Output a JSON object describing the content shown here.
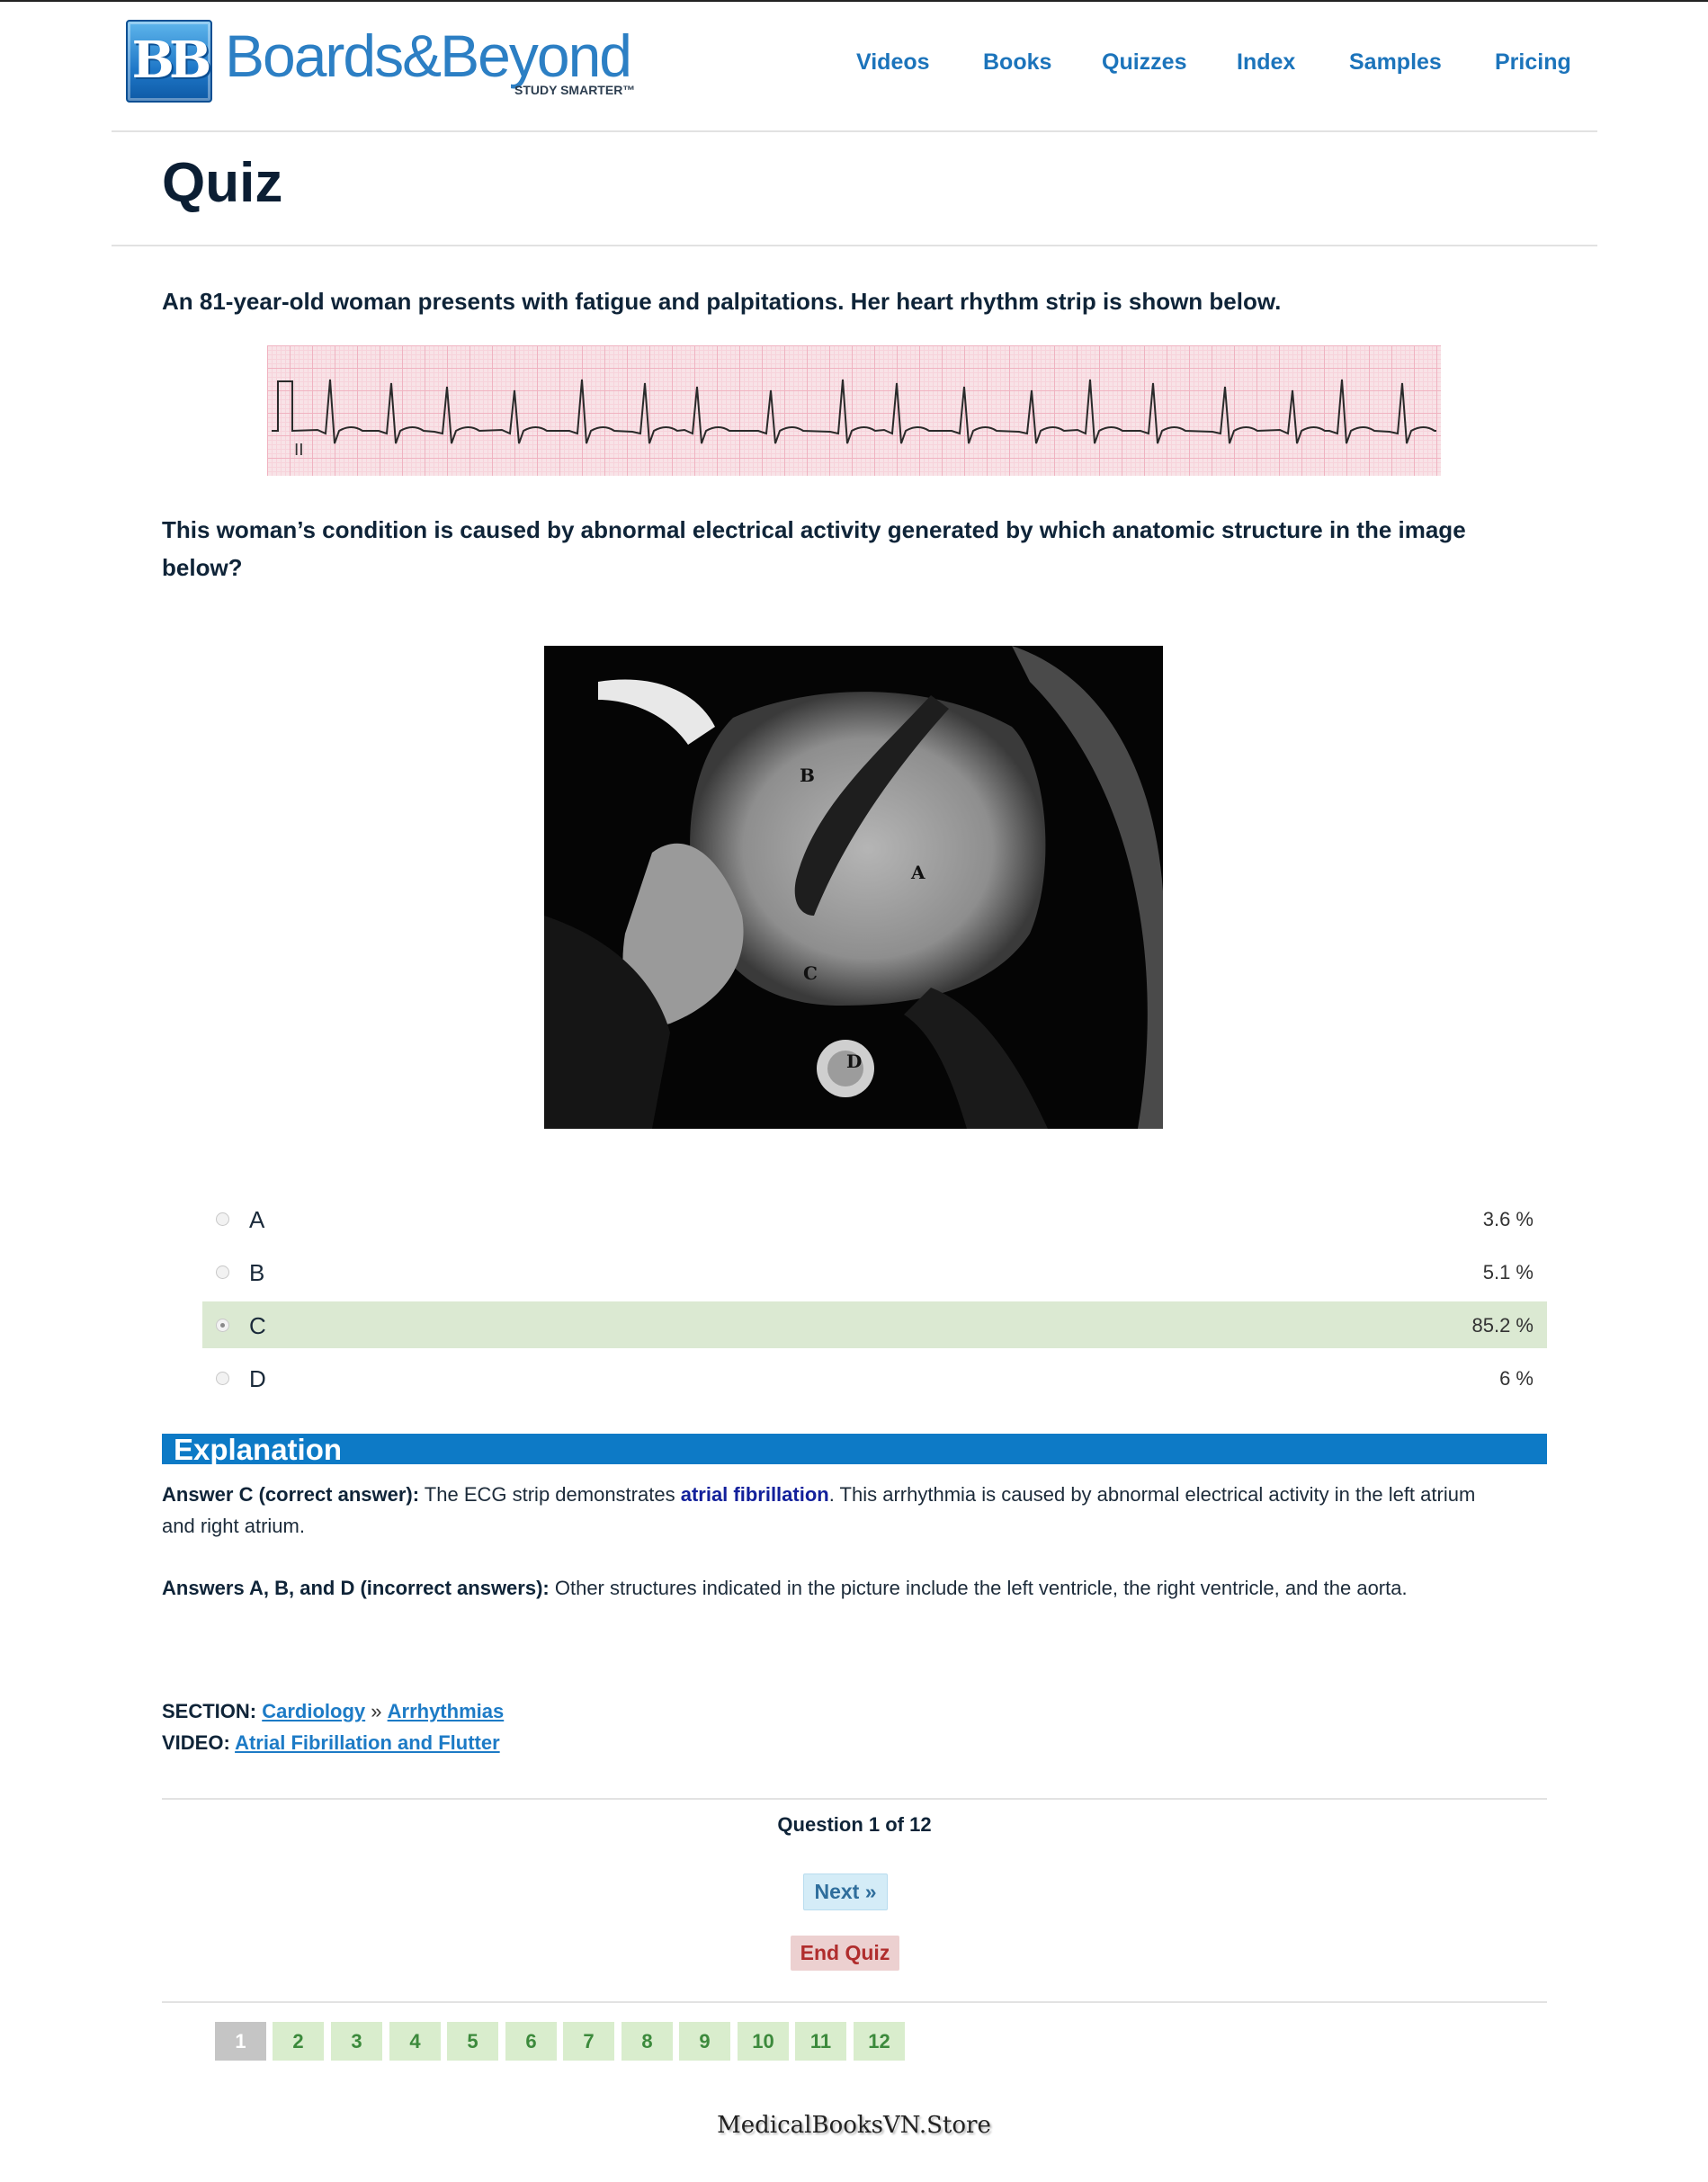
{
  "brand": {
    "badge": "BB",
    "name": "Boards&Beyond",
    "tagline": "STUDY SMARTER™"
  },
  "nav": [
    "Videos",
    "Books",
    "Quizzes",
    "Index",
    "Samples",
    "Pricing"
  ],
  "page_title": "Quiz",
  "question": {
    "stem": "An 81-year-old woman presents with fatigue and palpitations. Her heart rhythm strip is shown below.",
    "prompt_line1": "This woman’s condition is caused by abnormal electrical activity generated by which anatomic structure in the image",
    "prompt_line2": "below?",
    "ecg_lead_label": "II",
    "image_labels": [
      "A",
      "B",
      "C",
      "D"
    ]
  },
  "answers": [
    {
      "label": "A",
      "percent": "3.6 %",
      "selected": false
    },
    {
      "label": "B",
      "percent": "5.1 %",
      "selected": false
    },
    {
      "label": "C",
      "percent": "85.2 %",
      "selected": true
    },
    {
      "label": "D",
      "percent": "6 %",
      "selected": false
    }
  ],
  "explanation": {
    "heading": "Explanation",
    "p1_bold": "Answer C (correct answer):",
    "p1_text_a": " The ECG strip demonstrates ",
    "p1_keyword": "atrial fibrillation",
    "p1_text_b": ". This arrhythmia is caused by abnormal electrical activity in the left atrium",
    "p1_text_c": "and right atrium.",
    "p2_bold": "Answers A, B, and D (incorrect answers):",
    "p2_text": " Other structures indicated in the picture include the left ventricle, the right ventricle, and the aorta."
  },
  "meta": {
    "section_label": "SECTION:",
    "section_link1": "Cardiology",
    "section_sep": " » ",
    "section_link2": "Arrhythmias",
    "video_label": "VIDEO:",
    "video_link": "Atrial Fibrillation and Flutter"
  },
  "navigation": {
    "counter": "Question 1 of 12",
    "next": "Next »",
    "end": "End Quiz",
    "pages": [
      "1",
      "2",
      "3",
      "4",
      "5",
      "6",
      "7",
      "8",
      "9",
      "10",
      "11",
      "12"
    ],
    "current_page": "1"
  },
  "watermark": "MedicalBooksVN.Store",
  "colors": {
    "brand_blue": "#1c74bb",
    "explanation_bar": "#0d7ac6",
    "selected_row": "#dbe9d2",
    "page_button": "#d9edcd",
    "end_quiz": "#b02d2d"
  }
}
